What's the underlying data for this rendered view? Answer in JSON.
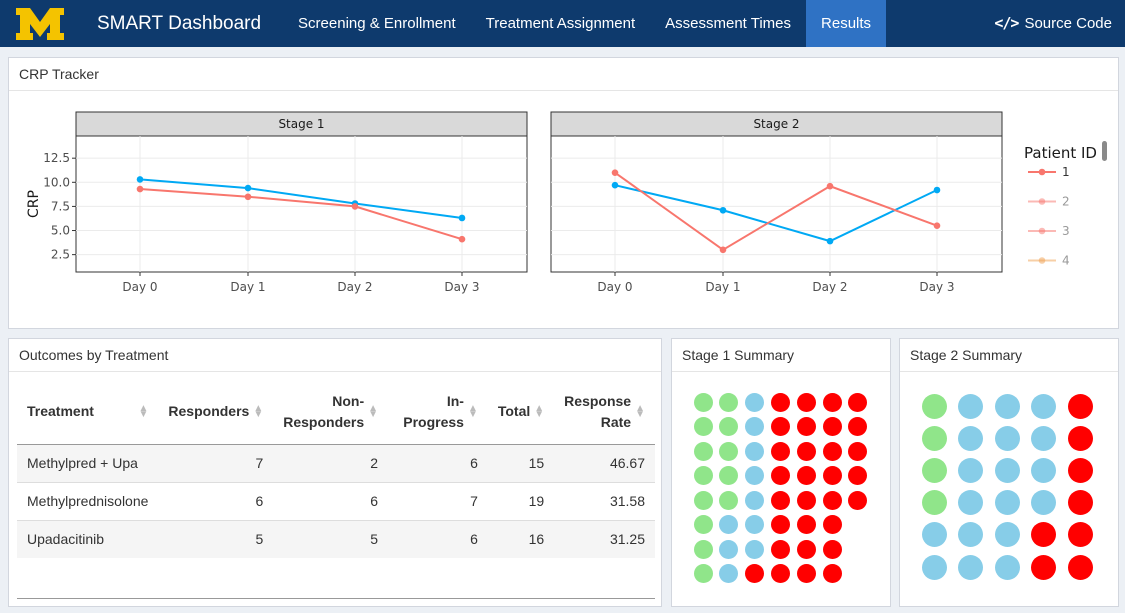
{
  "navbar": {
    "brand": "SMART Dashboard",
    "tabs": [
      {
        "label": "Screening & Enrollment",
        "active": false
      },
      {
        "label": "Treatment Assignment",
        "active": false
      },
      {
        "label": "Assessment Times",
        "active": false
      },
      {
        "label": "Results",
        "active": true
      }
    ],
    "source_code_label": "Source Code",
    "logo_icon": "block-m-logo-icon",
    "colors": {
      "bar": "#0e3a6d",
      "active": "#2f72c4",
      "logo": "#f4c300"
    }
  },
  "crp_tracker": {
    "title": "CRP Tracker",
    "chart_data": {
      "type": "line",
      "facets": [
        "Stage 1",
        "Stage 2"
      ],
      "categories": [
        "Day 0",
        "Day 1",
        "Day 2",
        "Day 3"
      ],
      "ylabel": "CRP",
      "yticks": [
        2.5,
        5.0,
        7.5,
        10.0,
        12.5
      ],
      "ylim": [
        0.7,
        14.8
      ],
      "legend_title": "Patient ID",
      "legend_placement": "right",
      "legend": [
        {
          "label": "1",
          "color": "#f8766d",
          "faded": false
        },
        {
          "label": "2",
          "color": "#f8766d",
          "faded": true
        },
        {
          "label": "3",
          "color": "#f8766d",
          "faded": true
        },
        {
          "label": "4",
          "color": "#f0a050",
          "faded": true
        }
      ],
      "panels": [
        {
          "facet": "Stage 1",
          "series": [
            {
              "color": "#00a9f4",
              "values": [
                10.3,
                9.4,
                7.8,
                6.3
              ]
            },
            {
              "color": "#f8766d",
              "values": [
                9.3,
                8.5,
                7.5,
                4.1
              ]
            }
          ]
        },
        {
          "facet": "Stage 2",
          "series": [
            {
              "color": "#00a9f4",
              "values": [
                9.7,
                7.1,
                3.9,
                9.2
              ]
            },
            {
              "color": "#f8766d",
              "values": [
                11.0,
                3.0,
                9.6,
                5.5
              ]
            }
          ]
        }
      ],
      "grid": true
    }
  },
  "outcomes": {
    "title": "Outcomes by Treatment",
    "columns": [
      "Treatment",
      "Responders",
      "Non-\nResponders",
      "In-\nProgress",
      "Total",
      "Response\nRate"
    ],
    "rows": [
      [
        "Methylpred + Upa",
        "7",
        "2",
        "6",
        "15",
        "46.67"
      ],
      [
        "Methylprednisolone",
        "6",
        "6",
        "7",
        "19",
        "31.58"
      ],
      [
        "Upadacitinib",
        "5",
        "5",
        "6",
        "16",
        "31.25"
      ]
    ]
  },
  "stage1_summary": {
    "title": "Stage 1 Summary",
    "rows": [
      [
        "green",
        "green",
        "blue",
        "red",
        "red",
        "red",
        "red"
      ],
      [
        "green",
        "green",
        "blue",
        "red",
        "red",
        "red",
        "red"
      ],
      [
        "green",
        "green",
        "blue",
        "red",
        "red",
        "red",
        "red"
      ],
      [
        "green",
        "green",
        "blue",
        "red",
        "red",
        "red",
        "red"
      ],
      [
        "green",
        "green",
        "blue",
        "red",
        "red",
        "red",
        "red"
      ],
      [
        "green",
        "blue",
        "blue",
        "red",
        "red",
        "red"
      ],
      [
        "green",
        "blue",
        "blue",
        "red",
        "red",
        "red"
      ],
      [
        "green",
        "blue",
        "red",
        "red",
        "red",
        "red"
      ]
    ]
  },
  "stage2_summary": {
    "title": "Stage 2 Summary",
    "rows": [
      [
        "green",
        "blue",
        "blue",
        "blue",
        "red"
      ],
      [
        "green",
        "blue",
        "blue",
        "blue",
        "red"
      ],
      [
        "green",
        "blue",
        "blue",
        "blue",
        "red"
      ],
      [
        "green",
        "blue",
        "blue",
        "blue",
        "red"
      ],
      [
        "blue",
        "blue",
        "blue",
        "red",
        "red"
      ],
      [
        "blue",
        "blue",
        "blue",
        "red",
        "red"
      ]
    ]
  },
  "dot_colors": {
    "green": "#90e58a",
    "blue": "#87cde8",
    "red": "#ff0000"
  }
}
